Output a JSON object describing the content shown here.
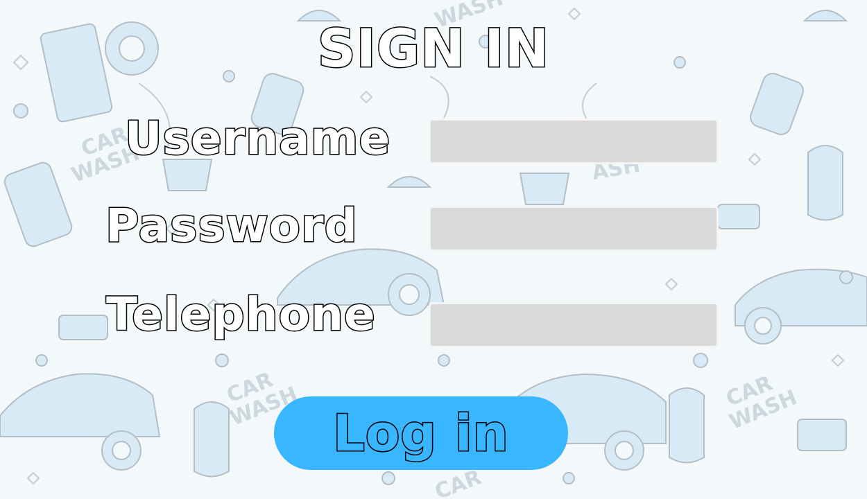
{
  "form": {
    "title": "SIGN IN",
    "fields": [
      {
        "label": "Username",
        "value": "",
        "placeholder": ""
      },
      {
        "label": "Password",
        "value": "",
        "placeholder": ""
      },
      {
        "label": "Telephone",
        "value": "",
        "placeholder": ""
      }
    ],
    "submit_label": "Log in"
  },
  "background": {
    "pattern": "car-wash-doodles",
    "watermark_text": "CAR WASH"
  },
  "colors": {
    "button_fill": "#38b6ff",
    "input_fill": "#d9d9d9",
    "doodle_blue": "#cde4f2",
    "doodle_line": "#9aa7b0"
  }
}
